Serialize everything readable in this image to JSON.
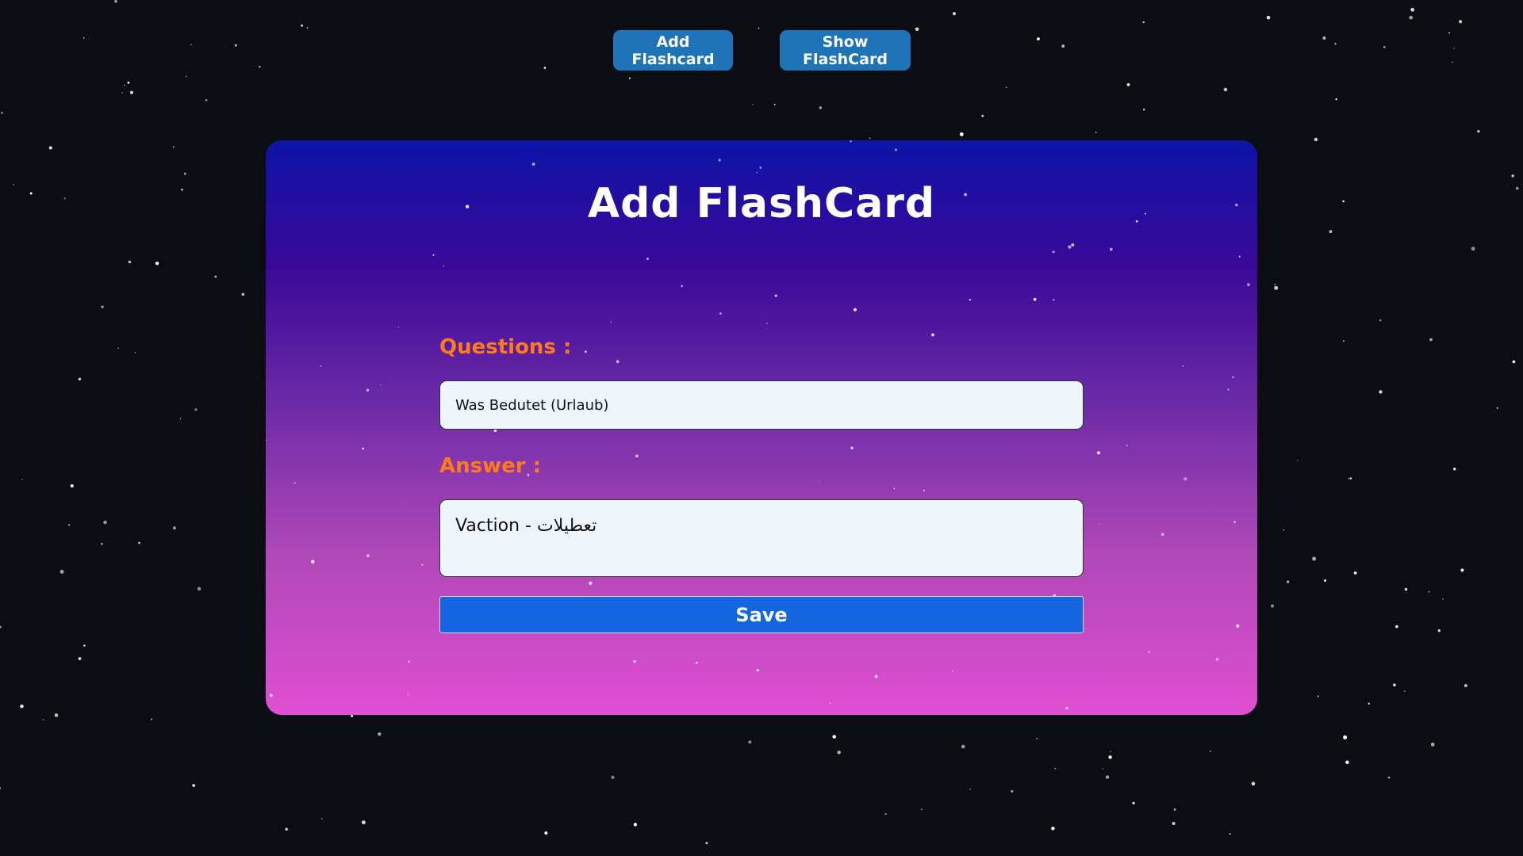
{
  "nav": {
    "add_label": "Add Flashcard",
    "show_label": "Show FlashCard"
  },
  "card": {
    "title": "Add FlashCard",
    "question_label": "Questions :",
    "question_value": "Was Bedutet (Urlaub)",
    "answer_label": "Answer :",
    "answer_value": "Vaction - تعطيلات",
    "save_label": "Save"
  },
  "colors": {
    "page_background": "#0b0d12",
    "nav_button": "#1f74b8",
    "label": "#ff7a1a",
    "save_button": "#1565e0",
    "input_background": "#eef6fc"
  }
}
